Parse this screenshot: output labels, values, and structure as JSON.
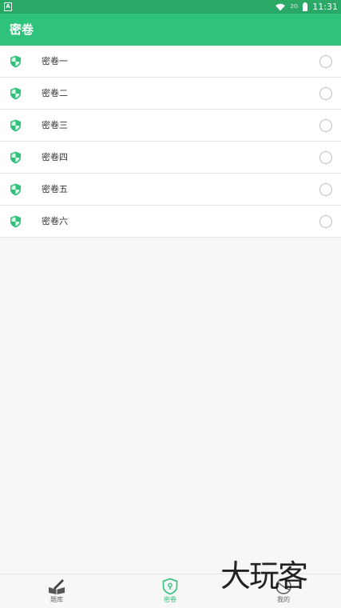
{
  "status_bar": {
    "sim_label": "A",
    "network_label": "2G",
    "time": "11:31",
    "icons": [
      "wifi-icon",
      "signal-icon",
      "battery-icon"
    ]
  },
  "app_bar": {
    "title": "密卷"
  },
  "list": {
    "items": [
      {
        "label": "密卷一",
        "icon": "shield-icon",
        "selected": false
      },
      {
        "label": "密卷二",
        "icon": "shield-icon",
        "selected": false
      },
      {
        "label": "密卷三",
        "icon": "shield-icon",
        "selected": false
      },
      {
        "label": "密卷四",
        "icon": "shield-icon",
        "selected": false
      },
      {
        "label": "密卷五",
        "icon": "shield-icon",
        "selected": false
      },
      {
        "label": "密卷六",
        "icon": "shield-icon",
        "selected": false
      }
    ]
  },
  "tabs": [
    {
      "label": "题库",
      "icon": "book-pencil-icon",
      "active": false
    },
    {
      "label": "密卷",
      "icon": "shield-lock-icon",
      "active": true
    },
    {
      "label": "我的",
      "icon": "profile-icon",
      "active": false
    }
  ],
  "watermark": {
    "text": "大玩客"
  },
  "colors": {
    "primary": "#2ec27a",
    "status_bar": "#2aa865",
    "radio_border": "#b9c0c4",
    "background": "#f7f7f7"
  }
}
